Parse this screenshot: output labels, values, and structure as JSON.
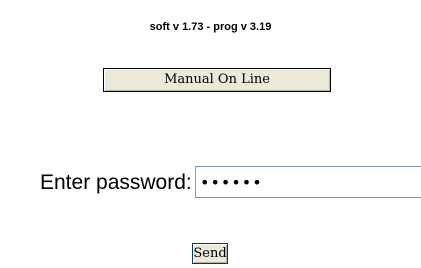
{
  "header": {
    "version_text": "soft v 1.73 - prog v 3.19"
  },
  "manual": {
    "button_label": "Manual On Line"
  },
  "login": {
    "password_label": "Enter password:",
    "password_value": "123456",
    "send_label": "Send"
  },
  "colors": {
    "button_face": "#ece9d8",
    "input_border": "#7f9db9"
  }
}
